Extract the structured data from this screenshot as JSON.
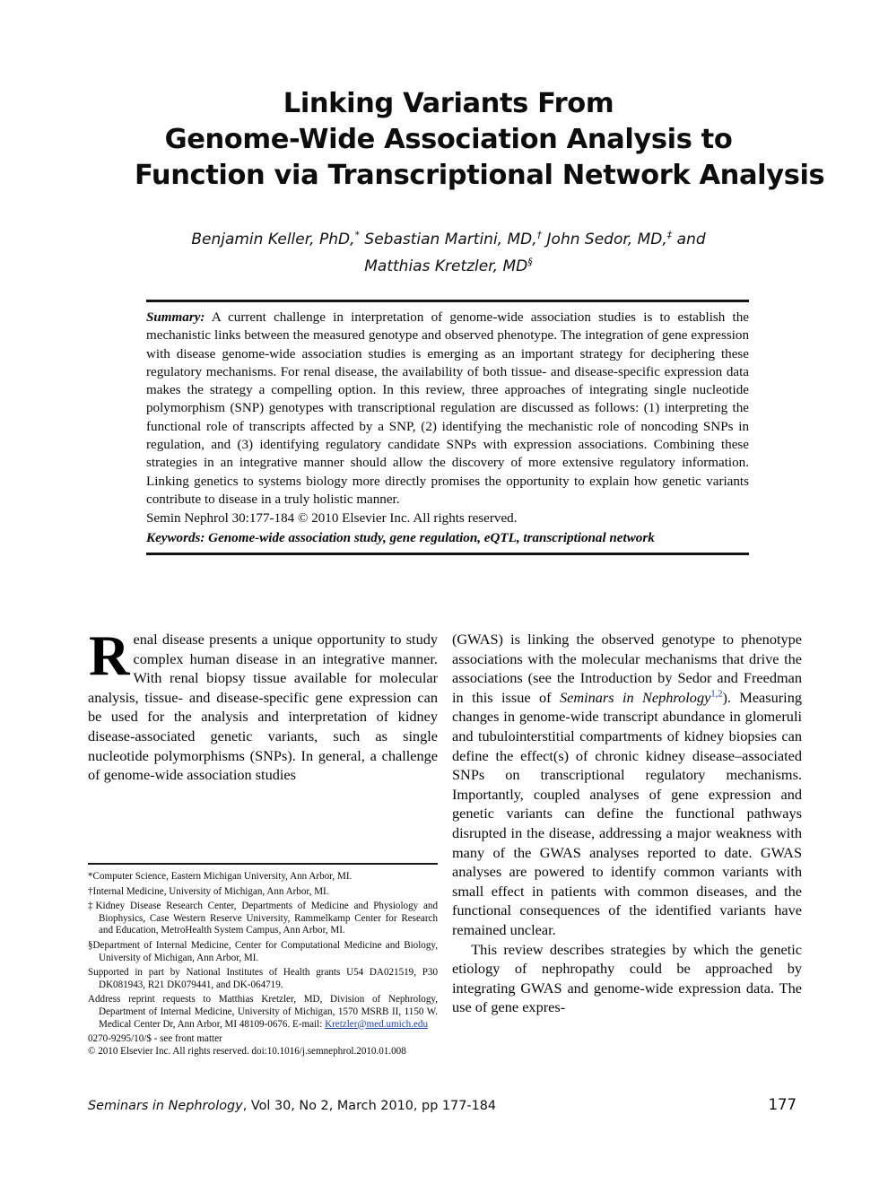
{
  "title": {
    "lines": [
      "Linking Variants From",
      "Genome-Wide Association Analysis to",
      "Function via Transcriptional Network Analysis"
    ]
  },
  "authors": {
    "line1_a": "Benjamin Keller, PhD,",
    "line1_m1": "*",
    "line1_b": " Sebastian Martini, MD,",
    "line1_m2": "†",
    "line1_c": " John Sedor, MD,",
    "line1_m3": "‡",
    "line1_d": " and",
    "line2_a": "Matthias Kretzler, MD",
    "line2_m": "§"
  },
  "abstract": {
    "label": "Summary:",
    "text": " A current challenge in interpretation of genome-wide association studies is to establish the mechanistic links between the measured genotype and observed phenotype. The integration of gene expression with disease genome-wide association studies is emerging as an important strategy for deciphering these regulatory mechanisms. For renal disease, the availability of both tissue- and disease-specific expression data makes the strategy a compelling option. In this review, three approaches of integrating single nucleotide polymorphism (SNP) genotypes with transcriptional regulation are discussed as follows: (1) interpreting the functional role of transcripts affected by a SNP, (2) identifying the mechanistic role of noncoding SNPs in regulation, and (3) identifying regulatory candidate SNPs with expression associations. Combining these strategies in an integrative manner should allow the discovery of more extensive regulatory information. Linking genetics to systems biology more directly promises the opportunity to explain how genetic variants contribute to disease in a truly holistic manner.",
    "citation": "Semin Nephrol 30:177-184 © 2010 Elsevier Inc. All rights reserved.",
    "keywords_label": "Keywords:",
    "keywords_text": " Genome-wide association study, gene regulation, eQTL, transcriptional network"
  },
  "body": {
    "left": {
      "dropcap": "R",
      "para1_a": "enal disease presents a unique opportunity to study complex human disease in an integrative manner. With renal biopsy tissue available for molecular analysis, tissue- and disease-specific gene expression can be used for the analysis and interpretation of kidney disease-associated genetic variants, such as single nucleotide polymorphisms (SNPs). In general, a challenge of genome-wide association studies"
    },
    "right": {
      "para1_a": "(GWAS) is linking the observed genotype to phenotype associations with the molecular mechanisms that drive the associations (see the Introduction by Sedor and Freedman in this issue of ",
      "para1_italic": "Seminars in Nephrology",
      "para1_sup": "1,2",
      "para1_b": "). Measuring changes in genome-wide transcript abundance in glomeruli and tubulointerstitial compartments of kidney biopsies can define the effect(s) of chronic kidney disease–associated SNPs on transcriptional regulatory mechanisms. Importantly, coupled analyses of gene expression and genetic variants can define the functional pathways disrupted in the disease, addressing a major weakness with many of the GWAS analyses reported to date. GWAS analyses are powered to identify common variants with small effect in patients with common diseases, and the functional consequences of the identified variants have remained unclear.",
      "para2": "This review describes strategies by which the genetic etiology of nephropathy could be approached by integrating GWAS and genome-wide expression data. The use of gene expres-"
    }
  },
  "footnotes": {
    "items": [
      "*Computer Science, Eastern Michigan University, Ann Arbor, MI.",
      "†Internal Medicine, University of Michigan, Ann Arbor, MI.",
      "‡Kidney Disease Research Center, Departments of Medicine and Physiology and Biophysics, Case Western Reserve University, Rammelkamp Center for Research and Education, MetroHealth System Campus, Ann Arbor, MI.",
      "§Department of Internal Medicine, Center for Computational Medicine and Biology, University of Michigan, Ann Arbor, MI.",
      "Supported in part by National Institutes of Health grants U54 DA021519, P30 DK081943, R21 DK079441, and DK-064719."
    ],
    "reprint_a": "Address reprint requests to Matthias Kretzler, MD, Division of Nephrology, Department of Internal Medicine, University of Michigan, 1570 MSRB II, 1150 W. Medical Center Dr, Ann Arbor, MI 48109-0676. E-mail: ",
    "reprint_email": "Kretzler@med.umich.edu",
    "issn_line": "0270-9295/10/$ - see front matter",
    "copyright_line": "© 2010 Elsevier Inc. All rights reserved. doi:10.1016/j.semnephrol.2010.01.008"
  },
  "footer": {
    "journal_italic": "Seminars in Nephrology",
    "journal_rest": ", Vol 30, No 2, March 2010, pp 177-184",
    "page_number": "177"
  }
}
